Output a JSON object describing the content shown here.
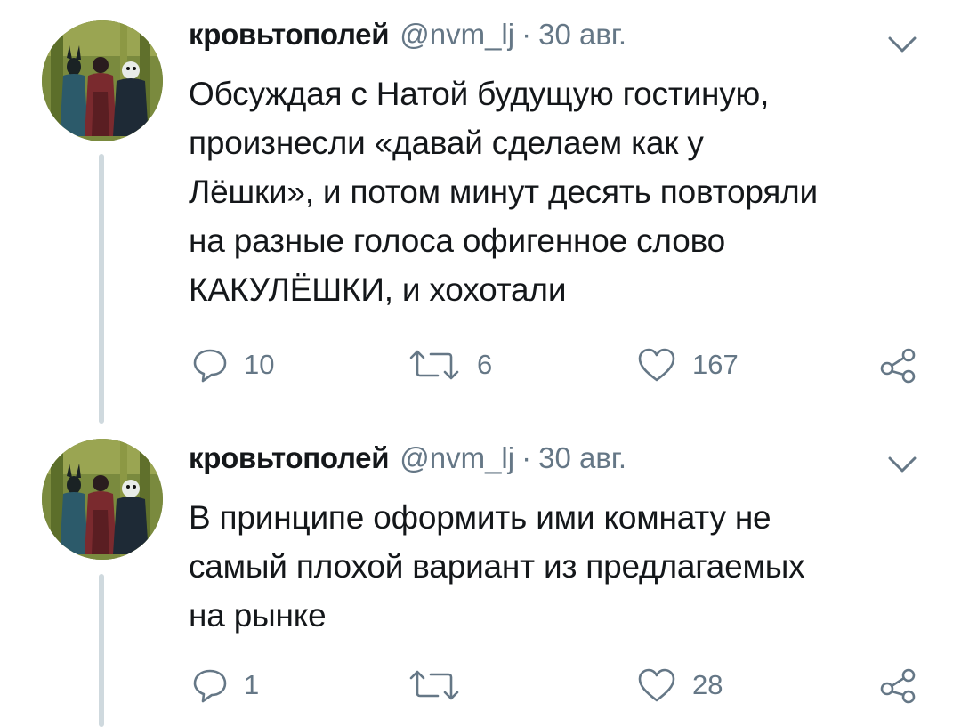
{
  "tweets": [
    {
      "name": "кровьтополей",
      "handle": "@nvm_lj",
      "separator": "·",
      "date": "30 авг.",
      "text_lines": [
        "Обсуждая с Натой будущую гостиную,",
        "произнесли «давай сделаем как у",
        "Лёшки», и потом минут десять повторяли",
        "на разные голоса офигенное слово",
        "КАКУЛЁШКИ, и хохотали"
      ],
      "replies": "10",
      "retweets": "6",
      "likes": "167"
    },
    {
      "name": "кровьтополей",
      "handle": "@nvm_lj",
      "separator": "·",
      "date": "30 авг.",
      "text_lines": [
        "В принципе оформить ими комнату не",
        "самый плохой вариант из предлагаемых",
        "на рынке"
      ],
      "replies": "1",
      "retweets": "",
      "likes": "28"
    }
  ],
  "icons": {
    "reply": "reply-icon",
    "retweet": "retweet-icon",
    "like": "heart-icon",
    "share": "share-icon",
    "menu": "chevron-down-icon"
  },
  "colors": {
    "text": "#14171a",
    "secondary": "#657786",
    "thread_line": "#cfd9de"
  }
}
